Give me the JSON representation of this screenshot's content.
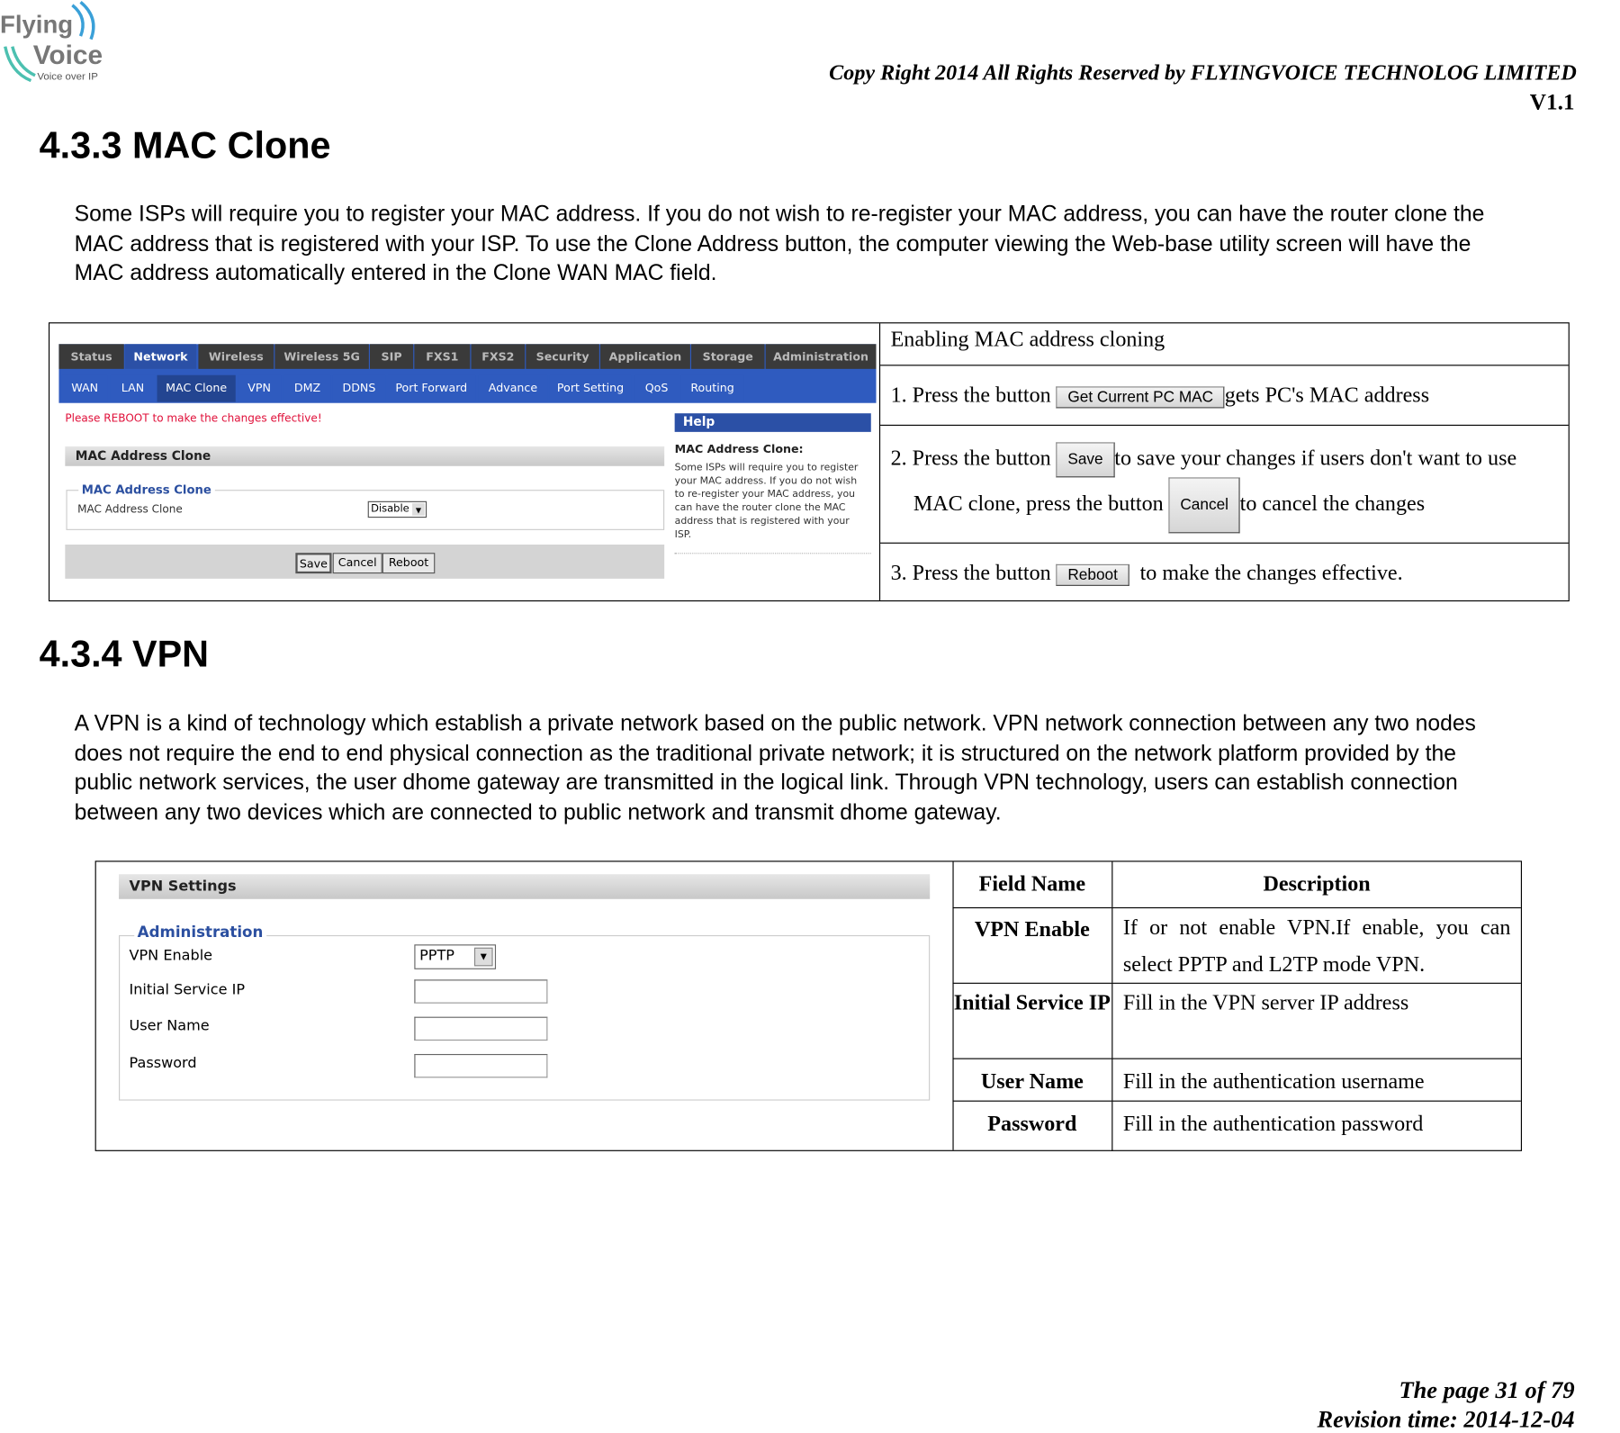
{
  "header": {
    "logo_text": "Flying Voice",
    "logo_sub": "Voice over IP",
    "copyright": "Copy Right 2014 All Rights Reserved by FLYINGVOICE TECHNOLOG LIMITED",
    "version": "V1.1"
  },
  "mac": {
    "heading": "4.3.3 MAC Clone",
    "para": [
      "Some ISPs will require you to register your MAC address. If you do not wish to re-register your MAC address, you can have the router clone the",
      "MAC address that is registered with your ISP. To use the Clone Address button, the computer viewing the Web-base utility screen will have the",
      "MAC address automatically entered in the Clone WAN MAC field."
    ],
    "screenshot": {
      "tabs": [
        "Status",
        "Network",
        "Wireless",
        "Wireless 5G",
        "SIP",
        "FXS1",
        "FXS2",
        "Security",
        "Application",
        "Storage",
        "Administration"
      ],
      "subtabs": [
        "WAN",
        "LAN",
        "MAC Clone",
        "VPN",
        "DMZ",
        "DDNS",
        "Port Forward",
        "Advance",
        "Port Setting",
        "QoS",
        "Routing"
      ],
      "notice": "Please REBOOT to make the changes effective!",
      "section": "MAC Address Clone",
      "legend": "MAC Address Clone",
      "field_label": "MAC Address Clone",
      "field_value": "Disable",
      "buttons": {
        "save": "Save",
        "cancel": "Cancel",
        "reboot": "Reboot"
      },
      "help_title": "Help",
      "help_heading": "MAC Address Clone:",
      "help_text": "Some ISPs will require you to register your MAC address. If you do not wish to re-register your MAC address, you can have the router clone the MAC address that is registered with your ISP."
    },
    "steps": {
      "title": "Enabling MAC address cloning",
      "s1a": "1. Press the button",
      "s1btn": "Get Current PC MAC",
      "s1b": "gets PC's MAC address",
      "s2a": "2. Press the button",
      "s2btn": "Save",
      "s2b": "to save your changes if users don't want to use",
      "s2c": "MAC clone, press the button",
      "s2btn2": "Cancel",
      "s2d": "to cancel the changes",
      "s3a": "3. Press the button",
      "s3btn": "Reboot",
      "s3b": "to make the changes effective."
    }
  },
  "vpn": {
    "heading": "4.3.4 VPN",
    "para": [
      "A VPN is a kind of technology which establish a private network based on the public network. VPN network connection between any two nodes",
      "does not require the end to end physical connection as the traditional private network; it is structured on the network platform provided by the",
      "public network services, the user dhome gateway are transmitted in the logical link. Through VPN technology, users can establish connection",
      "between any two devices which are connected to public network and transmit dhome gateway."
    ],
    "screenshot": {
      "section": "VPN Settings",
      "legend": "Administration",
      "labels": [
        "VPN Enable",
        "Initial Service IP",
        "User Name",
        "Password"
      ],
      "vpn_enable_value": "PPTP"
    },
    "table": {
      "headers": [
        "Field Name",
        "Description"
      ],
      "rows": [
        {
          "field": "VPN Enable",
          "desc": "If or not enable VPN.If enable, you can select PPTP and L2TP mode VPN."
        },
        {
          "field": "Initial Service IP",
          "desc": "Fill in the VPN server IP address"
        },
        {
          "field": "User Name",
          "desc": "Fill in the authentication username"
        },
        {
          "field": "Password",
          "desc": "Fill in the authentication password"
        }
      ]
    }
  },
  "footer": {
    "page": "The page 31 of 79",
    "revision": "Revision time: 2014-12-04"
  }
}
